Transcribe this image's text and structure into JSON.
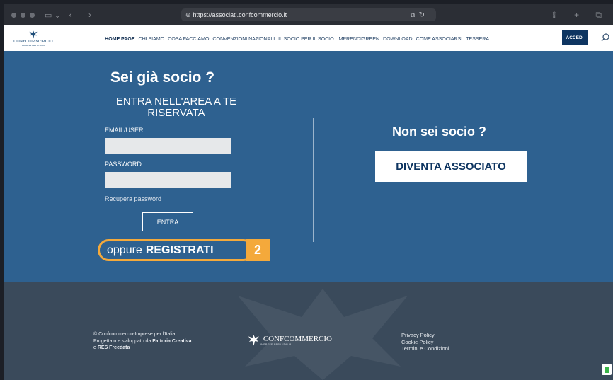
{
  "browser": {
    "url": "https://associati.confcommercio.it",
    "lock_icon": "globe-icon"
  },
  "header": {
    "logo_text": "CONFCOMMERCIO",
    "logo_sub": "IMPRESE PER L'ITALIA",
    "nav": [
      {
        "label": "HOME PAGE",
        "active": true
      },
      {
        "label": "CHI SIAMO"
      },
      {
        "label": "COSA FACCIAMO"
      },
      {
        "label": "CONVENZIONI NAZIONALI"
      },
      {
        "label": "IL SOCIO PER IL SOCIO"
      },
      {
        "label": "IMPRENDIGREEN"
      },
      {
        "label": "DOWNLOAD"
      },
      {
        "label": "COME ASSOCIARSI"
      },
      {
        "label": "TESSERA"
      }
    ],
    "accedi": "ACCEDI"
  },
  "login": {
    "title": "Sei già socio ?",
    "subtitle": "ENTRA NELL'AREA A TE RISERVATA",
    "email_label": "EMAIL/USER",
    "email_value": "",
    "password_label": "PASSWORD",
    "password_value": "",
    "recover": "Recupera password",
    "submit": "ENTRA",
    "register_prefix": "oppure",
    "register_label": "REGISTRATI",
    "step_badge": "2"
  },
  "join": {
    "title": "Non sei socio ?",
    "button": "DIVENTA ASSOCIATO"
  },
  "footer": {
    "line1": "© Confcommercio-Imprese per l'Italia",
    "line2_prefix": "Progettato e sviluppato da ",
    "line2_bold": "Fattoria Creativa",
    "line3_prefix": "e ",
    "line3_bold": "RES Freedata",
    "logo_text": "CONFCOMMERCIO",
    "logo_sub": "IMPRESE PER L'ITALIA",
    "links": [
      "Privacy Policy",
      "Cookie Policy",
      "Termini e Condizioni"
    ]
  },
  "colors": {
    "primary_blue": "#2e6190",
    "navy": "#0e3561",
    "highlight_orange": "#f4a93b",
    "footer_bg": "#3a4a5b"
  }
}
